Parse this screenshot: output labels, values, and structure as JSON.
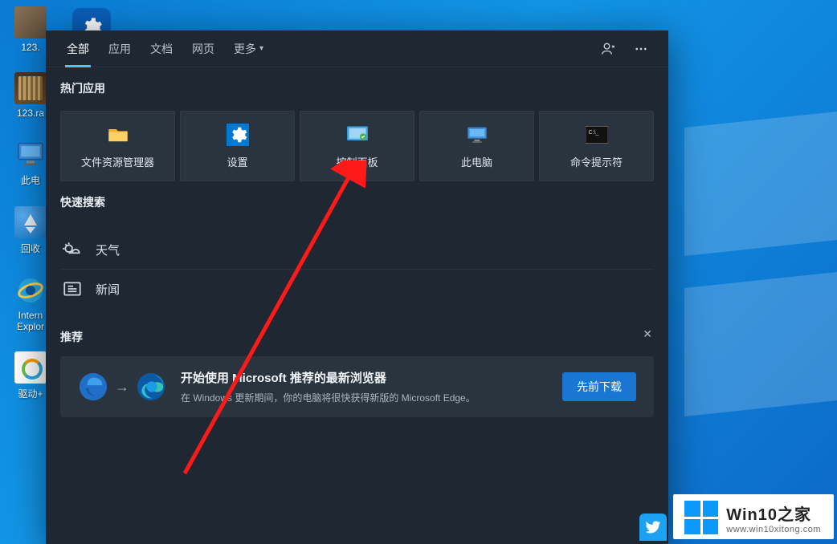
{
  "desktop": {
    "icon1_label": "123.",
    "icon2_label": "123.ra",
    "icon3_label": "此电",
    "icon4_label": "回收",
    "icon5_label": "Intern",
    "icon5_label2": "Explor",
    "icon6_label": "驱动+"
  },
  "tabs": {
    "all": "全部",
    "apps": "应用",
    "docs": "文档",
    "web": "网页",
    "more": "更多"
  },
  "sections": {
    "top_apps": "热门应用",
    "quick_search": "快速搜索",
    "recommend": "推荐"
  },
  "tiles": {
    "explorer": "文件资源管理器",
    "settings": "设置",
    "control_panel": "控制面板",
    "this_pc": "此电脑",
    "cmd": "命令提示符"
  },
  "quick": {
    "weather": "天气",
    "news": "新闻"
  },
  "rec": {
    "heading": "开始使用 Microsoft 推荐的最新浏览器",
    "sub": "在 Windows 更新期间，你的电脑将很快获得新版的 Microsoft Edge。",
    "button": "先前下载"
  },
  "watermark": {
    "title": "Win10之家",
    "url": "www.win10xitong.com"
  }
}
